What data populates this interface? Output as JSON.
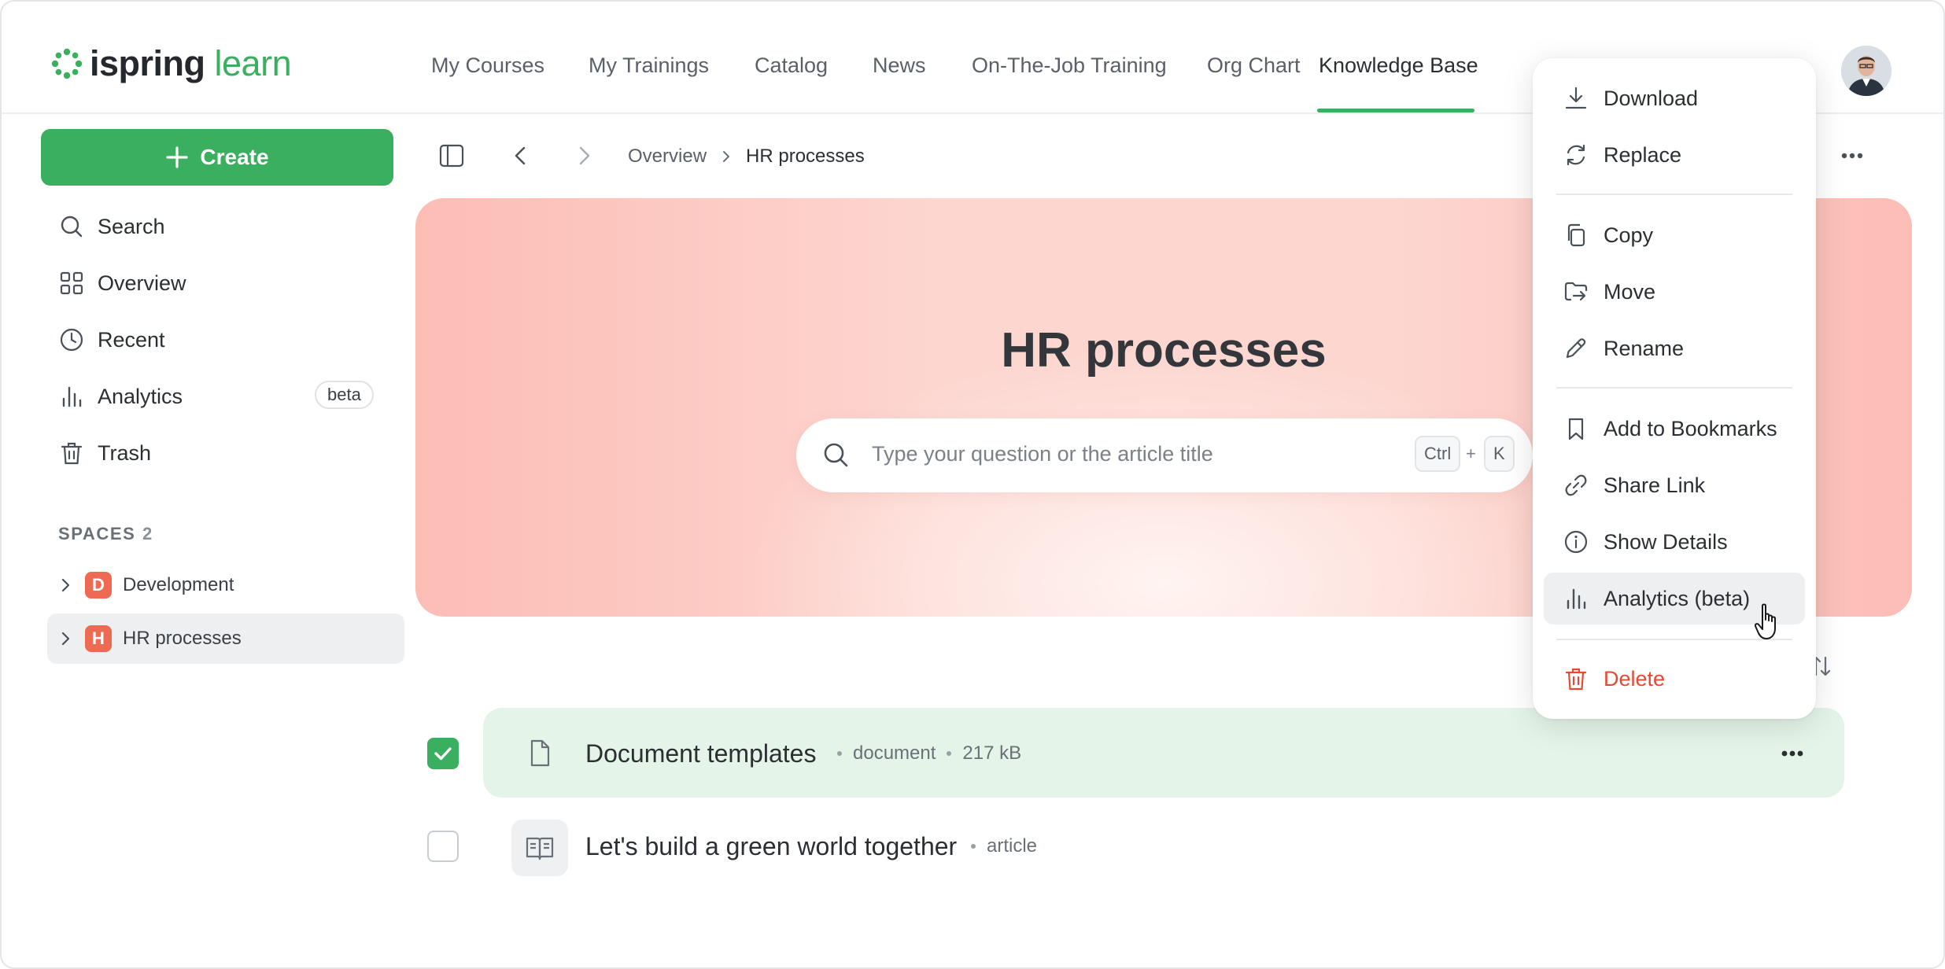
{
  "brand": {
    "name_part1": "ispring",
    "name_part2": "learn",
    "accent": "#3aaf5f"
  },
  "nav": {
    "items": [
      "My Courses",
      "My Trainings",
      "Catalog",
      "News",
      "On-The-Job Training",
      "Org Chart",
      "Knowledge Base"
    ],
    "active": "Knowledge Base"
  },
  "sidebar": {
    "create_label": "Create",
    "items": [
      {
        "label": "Search",
        "icon": "search-icon"
      },
      {
        "label": "Overview",
        "icon": "grid-icon"
      },
      {
        "label": "Recent",
        "icon": "clock-icon"
      },
      {
        "label": "Analytics",
        "icon": "bar-chart-icon",
        "badge": "beta"
      },
      {
        "label": "Trash",
        "icon": "trash-icon"
      }
    ],
    "spaces_label": "SPACES",
    "spaces_count": "2",
    "spaces": [
      {
        "letter": "D",
        "name": "Development",
        "selected": false
      },
      {
        "letter": "H",
        "name": "HR processes",
        "selected": true
      }
    ],
    "space_color": "#ee6a53"
  },
  "toolbar": {
    "breadcrumb": [
      "Overview",
      "HR processes"
    ]
  },
  "hero": {
    "title": "HR processes",
    "search_placeholder": "Type your question or the article title",
    "shortcut_key1": "Ctrl",
    "shortcut_plus": "+",
    "shortcut_key2": "K"
  },
  "list": {
    "items": [
      {
        "title": "Document templates",
        "type": "document",
        "size": "217 kB",
        "checked": true,
        "icon": "file-icon"
      },
      {
        "title": "Let's build a green world together",
        "type": "article",
        "checked": false,
        "icon": "book-icon"
      }
    ]
  },
  "context_menu": {
    "groups": [
      [
        {
          "label": "Download",
          "icon": "download-icon"
        },
        {
          "label": "Replace",
          "icon": "replace-icon"
        }
      ],
      [
        {
          "label": "Copy",
          "icon": "copy-icon"
        },
        {
          "label": "Move",
          "icon": "move-icon"
        },
        {
          "label": "Rename",
          "icon": "pencil-icon"
        }
      ],
      [
        {
          "label": "Add to Bookmarks",
          "icon": "bookmark-icon"
        },
        {
          "label": "Share Link",
          "icon": "link-icon"
        },
        {
          "label": "Show Details",
          "icon": "info-icon"
        },
        {
          "label": "Analytics (beta)",
          "icon": "bar-chart-icon",
          "hovered": true
        }
      ],
      [
        {
          "label": "Delete",
          "icon": "trash-icon",
          "danger": true
        }
      ]
    ],
    "danger_color": "#e44a32"
  }
}
